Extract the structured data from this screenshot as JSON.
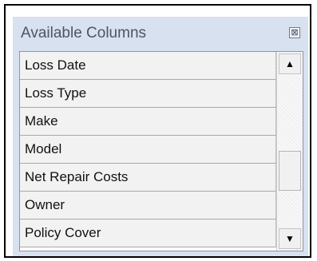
{
  "panel": {
    "title": "Available Columns",
    "close_glyph": "⊠",
    "close_icon": "close-box-icon"
  },
  "list": {
    "items": [
      "Loss Date",
      "Loss Type",
      "Make",
      "Model",
      "Net Repair Costs",
      "Owner",
      "Policy Cover"
    ]
  },
  "scrollbar": {
    "up_glyph": "▲",
    "down_glyph": "▼",
    "up_icon": "arrow-up-icon",
    "down_icon": "arrow-down-icon"
  }
}
